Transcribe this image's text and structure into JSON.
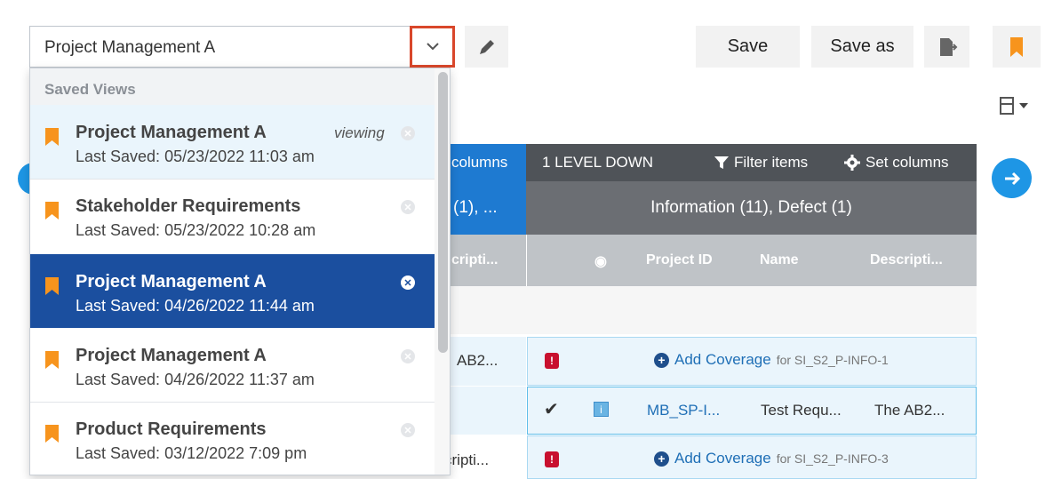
{
  "toolbar": {
    "view_name": "Project Management A",
    "save_label": "Save",
    "save_as_label": "Save as",
    "icons": {
      "dropdown": "chevron-down-icon",
      "edit": "pencil-icon",
      "export": "export-icon",
      "bookmark": "bookmark-icon",
      "split": "split-view-icon",
      "nav": "arrow-right-circle-icon"
    },
    "colors": {
      "accent": "#1e96e5",
      "dropdown_outline": "#d9472b",
      "bookmark": "#f7941d"
    }
  },
  "dropdown": {
    "header": "Saved Views",
    "viewing_label": "viewing",
    "items": [
      {
        "name": "Project Management A",
        "saved": "Last Saved: 05/23/2022 11:03 am",
        "current": true,
        "selected": false
      },
      {
        "name": "Stakeholder Requirements",
        "saved": "Last Saved: 05/23/2022 10:28 am",
        "current": false,
        "selected": false
      },
      {
        "name": "Project Management A",
        "saved": "Last Saved: 04/26/2022 11:44 am",
        "current": false,
        "selected": true
      },
      {
        "name": "Project Management A",
        "saved": "Last Saved: 04/26/2022 11:37 am",
        "current": false,
        "selected": false
      },
      {
        "name": "Product Requirements",
        "saved": "Last Saved: 03/12/2022 7:09 pm",
        "current": false,
        "selected": false
      }
    ]
  },
  "grid": {
    "left_header_1": "columns",
    "left_header_2": "(1), ...",
    "left_header_3": "cripti...",
    "level_label": "1 LEVEL DOWN",
    "filter_label": "Filter items",
    "set_columns_label": "Set columns",
    "group_header": "Information (11), Defect (1)",
    "columns": {
      "project_id": "Project ID",
      "name": "Name",
      "description": "Descripti..."
    },
    "rows": [
      {
        "left": "AB2...",
        "add_coverage": "Add Coverage",
        "for": "for SI_S2_P-INFO-1"
      },
      {
        "check": "✔",
        "id": "MB_SP-I...",
        "name": "Test Requ...",
        "description": "The AB2..."
      },
      {
        "left": "cripti...",
        "add_coverage": "Add Coverage",
        "for": "for SI_S2_P-INFO-3"
      }
    ]
  }
}
